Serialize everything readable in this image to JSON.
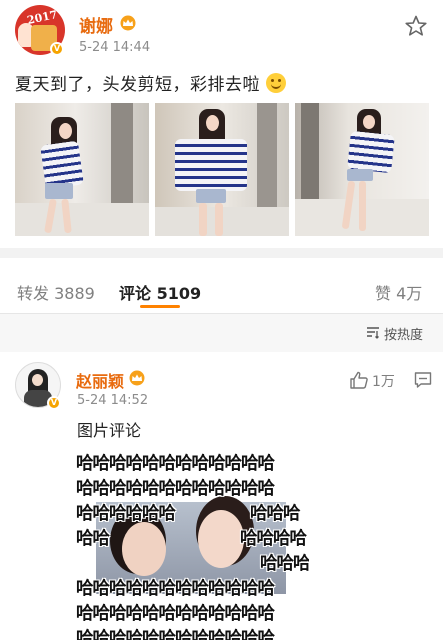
{
  "post": {
    "username": "谢娜",
    "time": "5-24 14:44",
    "text": "夏天到了，头发剪短，彩排去啦",
    "avatar_text": "2017",
    "favorite_icon": "star-outline-icon",
    "verified_icon": "vip-v-badge-icon",
    "member_icon": "crown-icon"
  },
  "tabs": {
    "repost_label": "转发",
    "repost_count": "3889",
    "comment_label": "评论",
    "comment_count": "5109",
    "like_label": "赞",
    "like_count": "4万"
  },
  "sort": {
    "label": "按热度",
    "icon": "sort-icon"
  },
  "comment": {
    "username": "赵丽颖",
    "time": "5-24 14:52",
    "like_count": "1万",
    "text": "图片评论",
    "like_icon": "thumbs-up-icon",
    "reply_icon": "message-icon",
    "meme_rows": [
      "哈哈哈哈哈哈哈哈哈哈哈哈",
      "哈哈哈哈哈哈哈哈哈哈哈哈",
      "哈哈哈哈哈哈",
      "哈哈",
      "哈哈哈哈哈哈哈哈哈哈哈哈",
      "哈哈哈哈哈哈哈哈哈哈哈哈",
      "哈哈哈哈哈哈哈哈哈哈哈哈"
    ],
    "meme_right_rows": [
      "哈哈哈",
      "哈哈哈哈",
      "哈哈哈"
    ]
  },
  "colors": {
    "username": "#e86b0f",
    "accent": "#ff8200",
    "muted": "#808080"
  }
}
